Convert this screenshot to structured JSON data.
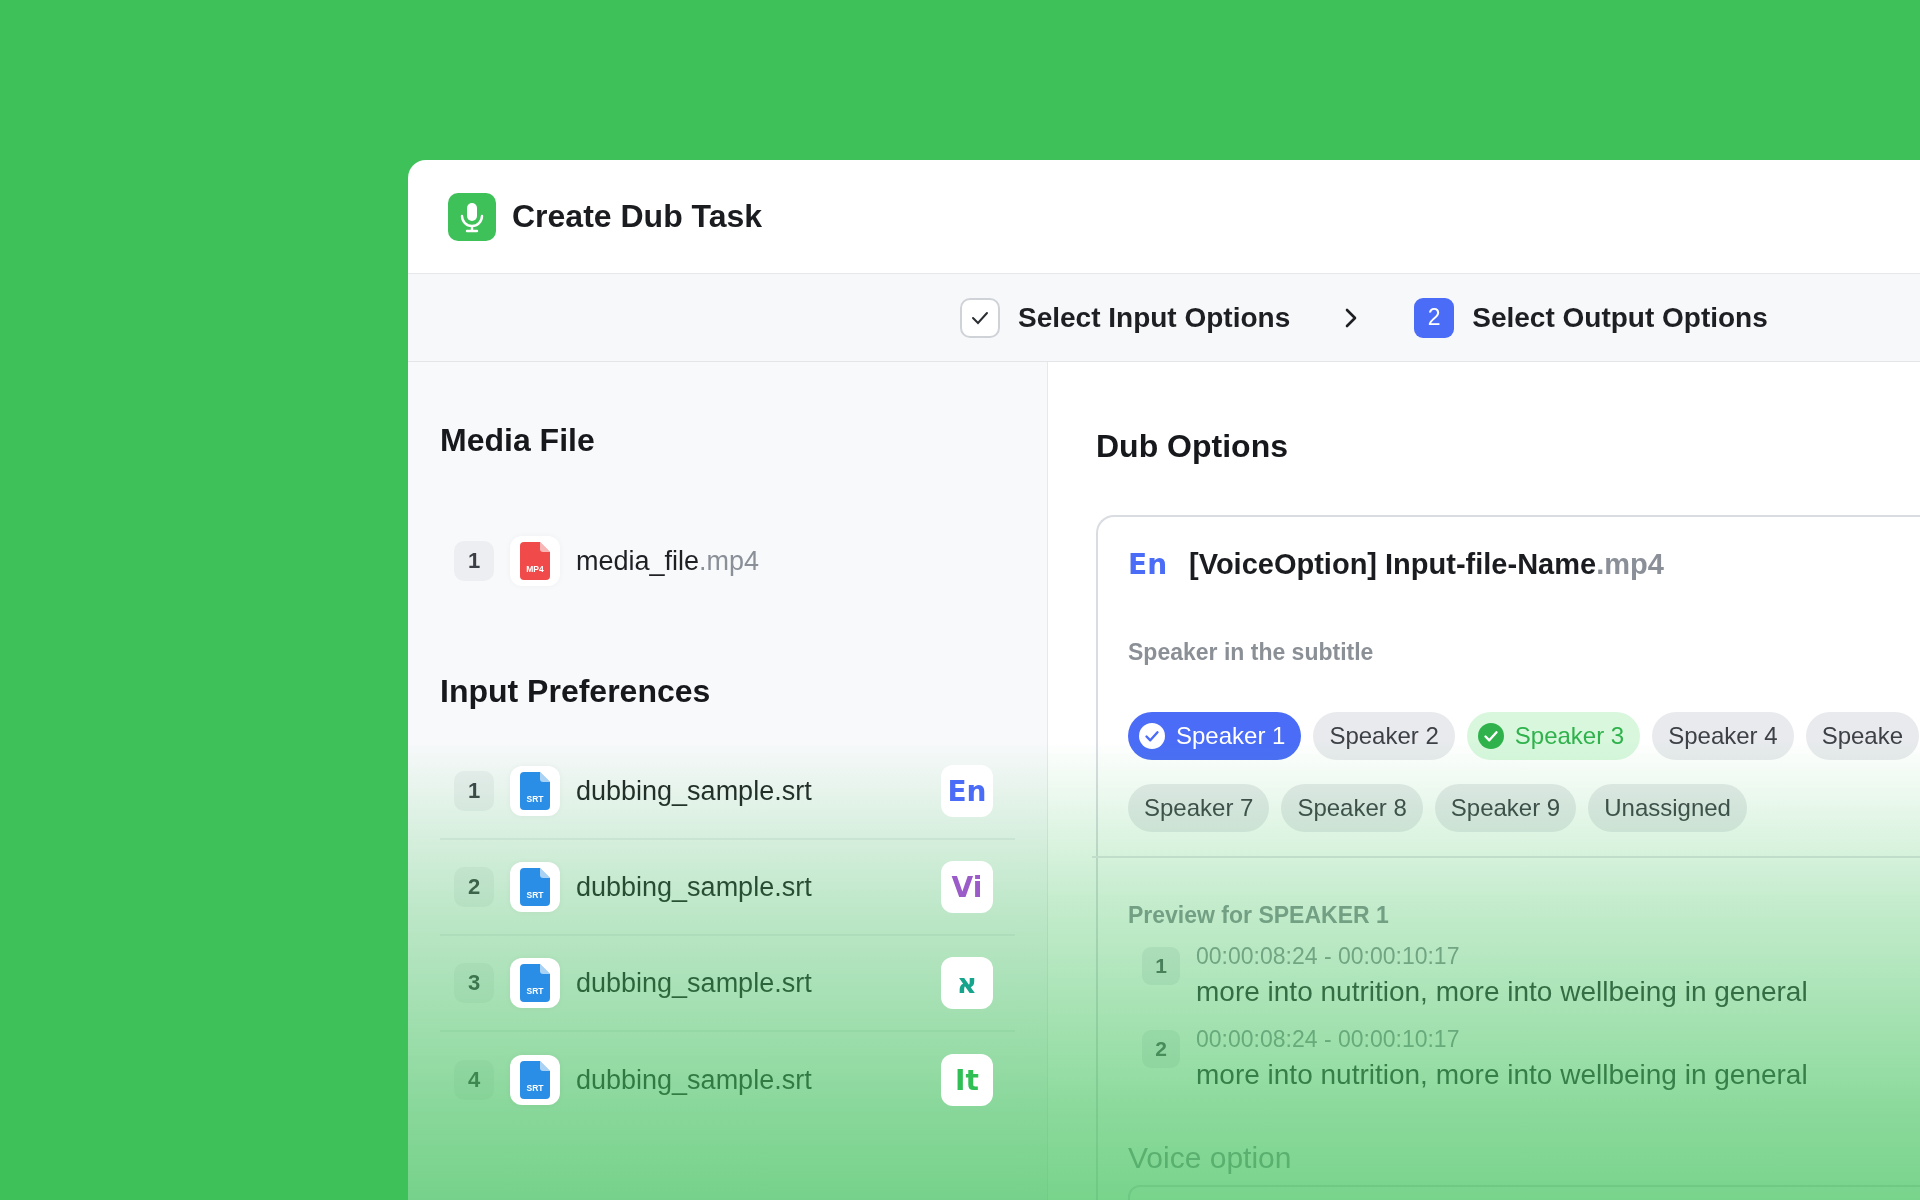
{
  "window": {
    "title": "Create Dub Task"
  },
  "steps": [
    {
      "label": "Select Input Options",
      "done": true
    },
    {
      "number": "2",
      "label": "Select Output Options",
      "done": false
    }
  ],
  "media_file": {
    "heading": "Media File",
    "files": [
      {
        "index": "1",
        "type": "MP4",
        "name": "media_file",
        "extension": ".mp4"
      }
    ]
  },
  "input_preferences": {
    "heading": "Input Preferences",
    "files": [
      {
        "index": "1",
        "type": "SRT",
        "name": "dubbing_sample.srt",
        "language": "En",
        "color": "#4a6cf7"
      },
      {
        "index": "2",
        "type": "SRT",
        "name": "dubbing_sample.srt",
        "language": "Vi",
        "color": "#9b5cc9"
      },
      {
        "index": "3",
        "type": "SRT",
        "name": "dubbing_sample.srt",
        "language": "א",
        "color": "#16a58c"
      },
      {
        "index": "4",
        "type": "SRT",
        "name": "dubbing_sample.srt",
        "language": "It",
        "color": "#2fbf55"
      }
    ]
  },
  "dub_options": {
    "heading": "Dub Options",
    "card": {
      "language": "En",
      "name": "[VoiceOption] Input-file-Name",
      "extension": ".mp4",
      "speakers_label": "Speaker in the subtitle",
      "speakers": [
        {
          "label": "Speaker 1",
          "selected": true,
          "assigned": false
        },
        {
          "label": "Speaker 2",
          "selected": false,
          "assigned": false
        },
        {
          "label": "Speaker 3",
          "selected": false,
          "assigned": true
        },
        {
          "label": "Speaker 4",
          "selected": false,
          "assigned": false
        },
        {
          "label": "Speake",
          "selected": false,
          "assigned": false
        },
        {
          "label": "Speaker 7",
          "selected": false,
          "assigned": false
        },
        {
          "label": "Speaker 8",
          "selected": false,
          "assigned": false
        },
        {
          "label": "Speaker 9",
          "selected": false,
          "assigned": false
        },
        {
          "label": "Unassigned",
          "selected": false,
          "assigned": false
        }
      ],
      "preview_label": "Preview for SPEAKER 1",
      "preview": [
        {
          "index": "1",
          "time": "00:00:08:24 - 00:00:10:17",
          "text": "more into nutrition, more into wellbeing in general"
        },
        {
          "index": "2",
          "time": "00:00:08:24 - 00:00:10:17",
          "text": "more into nutrition, more into wellbeing in general"
        }
      ],
      "voice_label": "Voice option"
    }
  }
}
